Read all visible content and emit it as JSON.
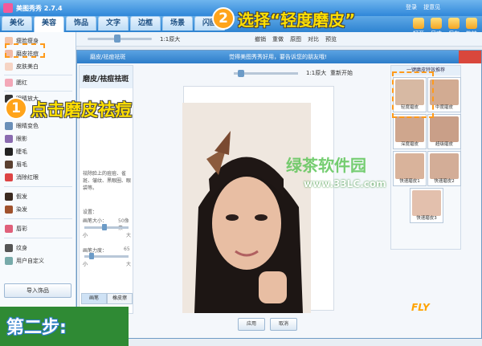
{
  "window": {
    "title": "美图秀秀 2.7.4",
    "links": [
      "登录",
      "提意见"
    ]
  },
  "tabs": [
    "美化",
    "美容",
    "饰品",
    "文字",
    "边框",
    "场景",
    "闪图"
  ],
  "right_tools": [
    "打开",
    "尺寸",
    "保存",
    "旋转"
  ],
  "left_panel": {
    "items": [
      "瘦脸瘦身",
      "磨皮祛痘",
      "皮肤美白",
      "腮红",
      "眼睛放大",
      "眼睛变色",
      "眼影",
      "睫毛",
      "眉毛",
      "消除红眼",
      "假发",
      "染发",
      "唇彩",
      "纹身",
      "用户自定义"
    ],
    "import_button": "导入饰品"
  },
  "main_toolbar": {
    "zoom_text": "1:1原大",
    "undo": "撤销",
    "redo": "重做",
    "original": "原图",
    "compare": "对比",
    "preview": "预览"
  },
  "dialog": {
    "title": "磨皮/祛痘祛斑",
    "notice": "觉得美图秀秀好用，要告诉您的朋友哦!",
    "panel_title": "磨皮/祛痘祛斑",
    "desc": "祛除脸上的痘痘、雀斑、皱纹、黑眼圈、眼袋等。",
    "settings_label": "设置：",
    "brush_size_label": "画笔大小：",
    "brush_size_value": "50像素",
    "small": "小",
    "large": "大",
    "brush_strength_label": "画笔力度：",
    "brush_strength_value": "65",
    "tab_brush": "画笔",
    "tab_erase": "橡皮擦",
    "preview_zoom": "1:1原大",
    "reset": "重新开始",
    "effects_header": "一键磨皮特效推荐",
    "effects": [
      "轻度磨皮",
      "中度磨皮",
      "深度磨皮",
      "超级磨皮",
      "快速磨皮1",
      "快速磨皮2",
      "快速磨皮3"
    ],
    "ok": "应用",
    "cancel": "取消"
  },
  "annotations": {
    "step1_number": "1",
    "step1_text": "点击磨皮祛痘",
    "step2_number": "2",
    "step2_text": "选择“轻度磨皮”",
    "step_label": "第二步:",
    "watermark": "绿茶软件园",
    "watermark_url": "www.33LC.com",
    "fly_logo": "FLY"
  }
}
